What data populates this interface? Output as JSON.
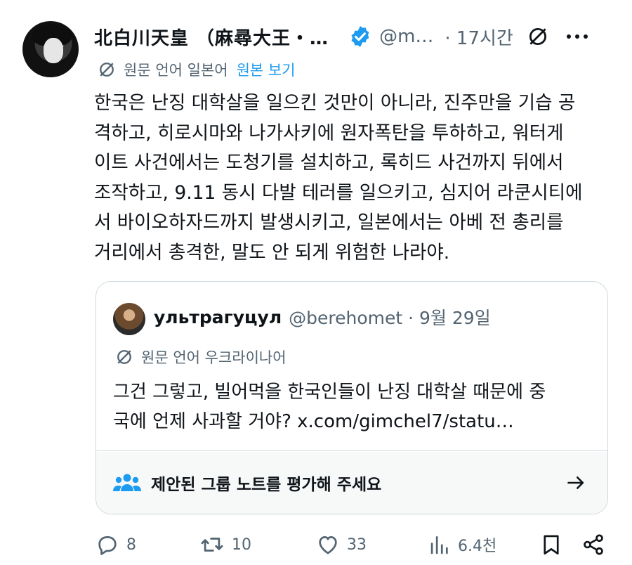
{
  "tweet": {
    "display_name": "北白川天皇 （麻尋大王・…",
    "handle": "@m…",
    "time": "· 17시간",
    "language_note": "원문 언어 일본어",
    "view_original": "원본 보기",
    "text": "한국은 난징 대학살을 일으킨 것만이 아니라, 진주만을 기습 공\n격하고, 히로시마와 나가사키에 원자폭탄을 투하하고, 워터게\n이트 사건에서는 도청기를 설치하고, 록히드 사건까지 뒤에서\n조작하고, 9.11 동시 다발 테러를 일으키고, 심지어 라쿤시티에\n서 바이오하자드까지 발생시키고, 일본에서는 아베 전 총리를\n거리에서 총격한, 말도 안 되게 위험한 나라야."
  },
  "quote": {
    "display_name": "ультрагуцул",
    "handle": "@berehomet · 9월 29일",
    "language_note": "원문 언어 우크라이나어",
    "text": "그건 그렇고, 빌어먹을 한국인들이 난징 대학살 때문에 중\n국에 언제 사과할 거야? x.com/gimchel7/statu…",
    "community_note_prompt": "제안된 그룹 노트를 평가해 주세요"
  },
  "actions": {
    "replies": "8",
    "retweets": "10",
    "likes": "33",
    "views": "6.4천"
  },
  "colors": {
    "text": "#0f1419",
    "secondary": "#536471",
    "link": "#1d9bf0",
    "verified": "#1d9bf0",
    "note_icon": "#1d9bf0",
    "border": "#cfd9de"
  },
  "icons": [
    "translate-icon",
    "verified-badge-icon",
    "more-icon",
    "people-icon",
    "arrow-right-icon",
    "reply-icon",
    "retweet-icon",
    "like-icon",
    "views-icon",
    "bookmark-icon",
    "share-icon"
  ]
}
